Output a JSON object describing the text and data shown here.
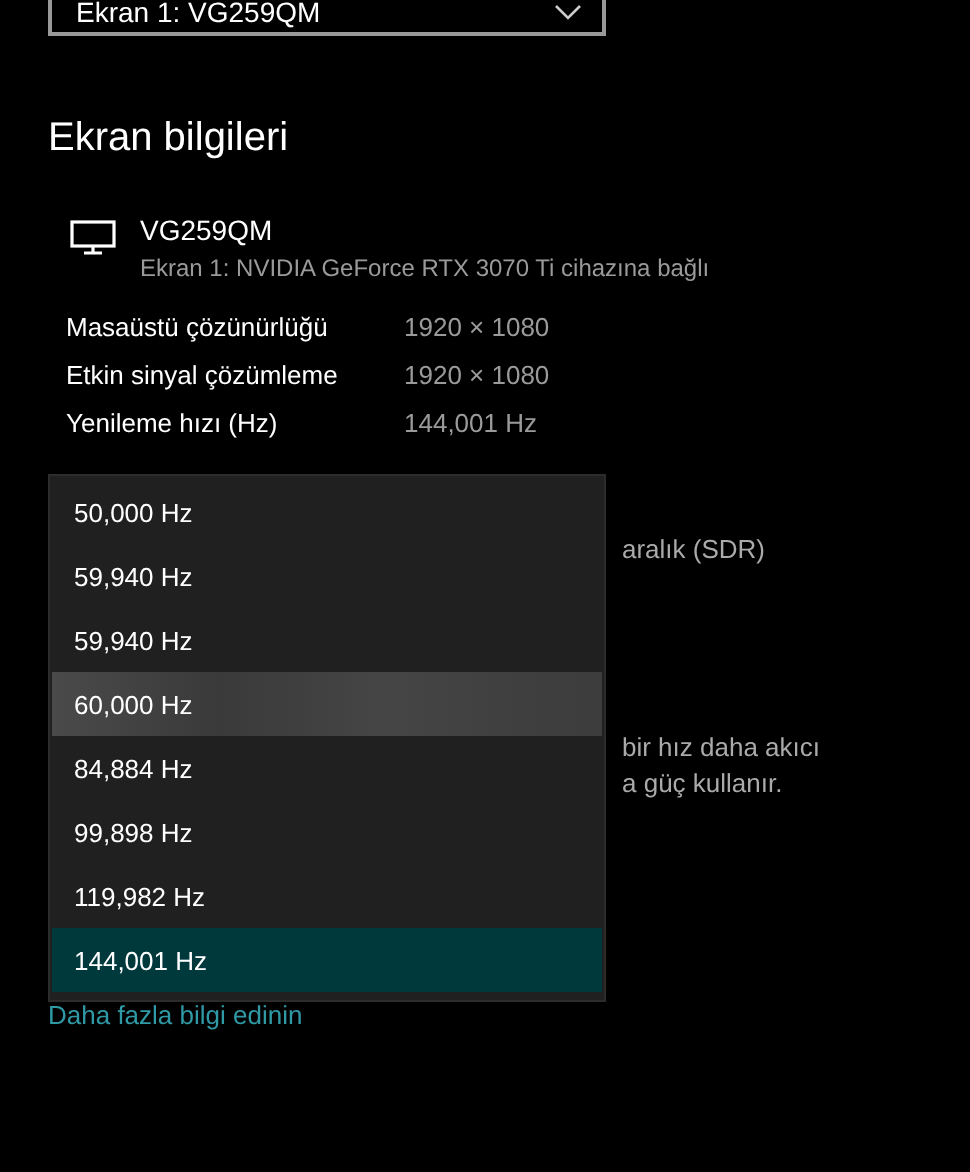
{
  "display_select": {
    "value": "Ekran 1: VG259QM"
  },
  "section_title": "Ekran bilgileri",
  "monitor": {
    "name": "VG259QM",
    "description": "Ekran 1: NVIDIA GeForce RTX 3070 Ti cihazına bağlı"
  },
  "info_rows": [
    {
      "label": "Masaüstü çözünürlüğü",
      "value": "1920 × 1080"
    },
    {
      "label": "Etkin sinyal çözümleme",
      "value": "1920 × 1080"
    },
    {
      "label": "Yenileme hızı (Hz)",
      "value": "144,001 Hz"
    }
  ],
  "covered_texts": [
    "aralık (SDR)",
    "bir hız daha akıcı",
    "a güç kullanır."
  ],
  "refresh_rate_menu": [
    {
      "label": "50,000 Hz",
      "selected": false,
      "hovered": false
    },
    {
      "label": "59,940 Hz",
      "selected": false,
      "hovered": false
    },
    {
      "label": "59,940 Hz",
      "selected": false,
      "hovered": false
    },
    {
      "label": "60,000 Hz",
      "selected": false,
      "hovered": true
    },
    {
      "label": "84,884 Hz",
      "selected": false,
      "hovered": false
    },
    {
      "label": "99,898 Hz",
      "selected": false,
      "hovered": false
    },
    {
      "label": "119,982 Hz",
      "selected": false,
      "hovered": false
    },
    {
      "label": "144,001 Hz",
      "selected": true,
      "hovered": false
    }
  ],
  "link": "Daha fazla bilgi edinin"
}
